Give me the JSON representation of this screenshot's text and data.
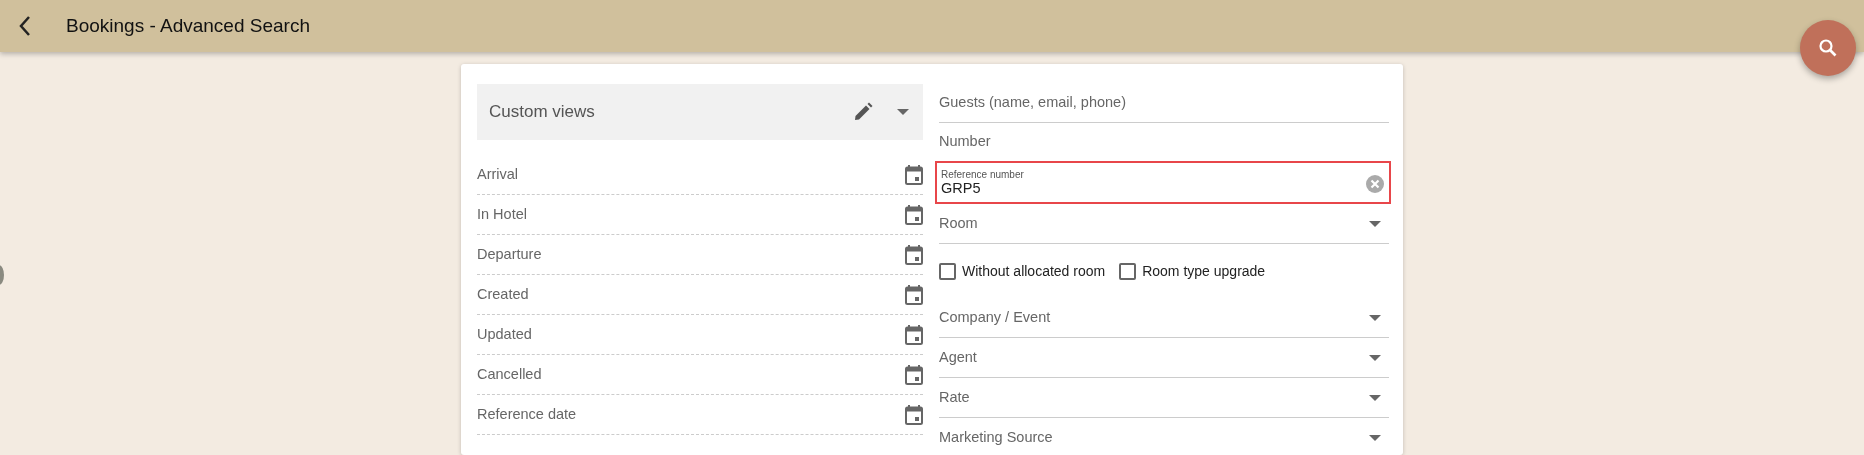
{
  "header": {
    "title": "Bookings - Advanced Search"
  },
  "custom_views": {
    "label": "Custom views"
  },
  "date_filters": [
    {
      "label": "Arrival"
    },
    {
      "label": "In Hotel"
    },
    {
      "label": "Departure"
    },
    {
      "label": "Created"
    },
    {
      "label": "Updated"
    },
    {
      "label": "Cancelled"
    },
    {
      "label": "Reference date"
    }
  ],
  "fields": [
    {
      "kind": "input",
      "placeholder": "Guests (name, email, phone)",
      "highlighted": false
    },
    {
      "kind": "input",
      "placeholder": "Number",
      "highlighted": false
    },
    {
      "kind": "filled",
      "label": "Reference number",
      "value": "GRP5",
      "highlighted": true
    },
    {
      "kind": "select",
      "label": "Room",
      "highlighted": false
    },
    {
      "kind": "checks",
      "options": [
        {
          "label": "Without allocated room",
          "checked": false
        },
        {
          "label": "Room type upgrade",
          "checked": false
        }
      ]
    },
    {
      "kind": "select",
      "label": "Company / Event",
      "highlighted": false
    },
    {
      "kind": "select",
      "label": "Agent",
      "highlighted": false
    },
    {
      "kind": "select",
      "label": "Rate",
      "highlighted": false
    },
    {
      "kind": "select",
      "label": "Marketing Source",
      "highlighted": false
    }
  ]
}
